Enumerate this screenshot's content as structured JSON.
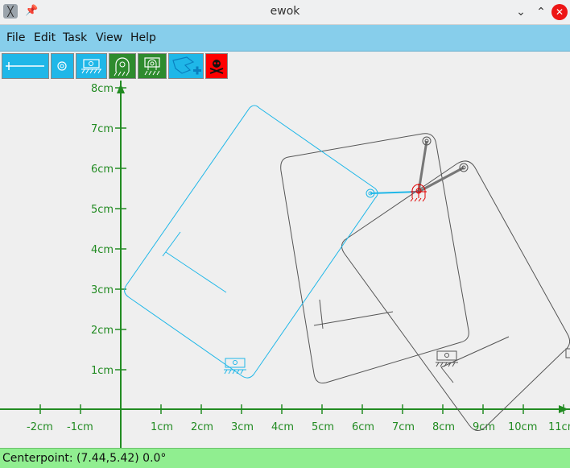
{
  "window": {
    "title": "ewok"
  },
  "menu": {
    "file": "File",
    "edit": "Edit",
    "task": "Task",
    "view": "View",
    "help": "Help"
  },
  "axes": {
    "x_ticks": [
      "-2cm",
      "-1cm",
      "1cm",
      "2cm",
      "3cm",
      "4cm",
      "5cm",
      "6cm",
      "7cm",
      "8cm",
      "9cm",
      "10cm",
      "11cm"
    ],
    "y_ticks": [
      "1cm",
      "2cm",
      "3cm",
      "4cm",
      "5cm",
      "6cm",
      "7cm",
      "8cm"
    ]
  },
  "colors": {
    "menubar": "#87ceeb",
    "toolbar_blue": "#1fb7e8",
    "toolbar_green": "#2e8b2e",
    "toolbar_red": "#ff0000",
    "axis": "#228b22",
    "selected": "#1fb7e8",
    "statusbar": "#90ee90"
  },
  "status": {
    "text": "Centerpoint: (7.44,5.42)  0.0°"
  }
}
